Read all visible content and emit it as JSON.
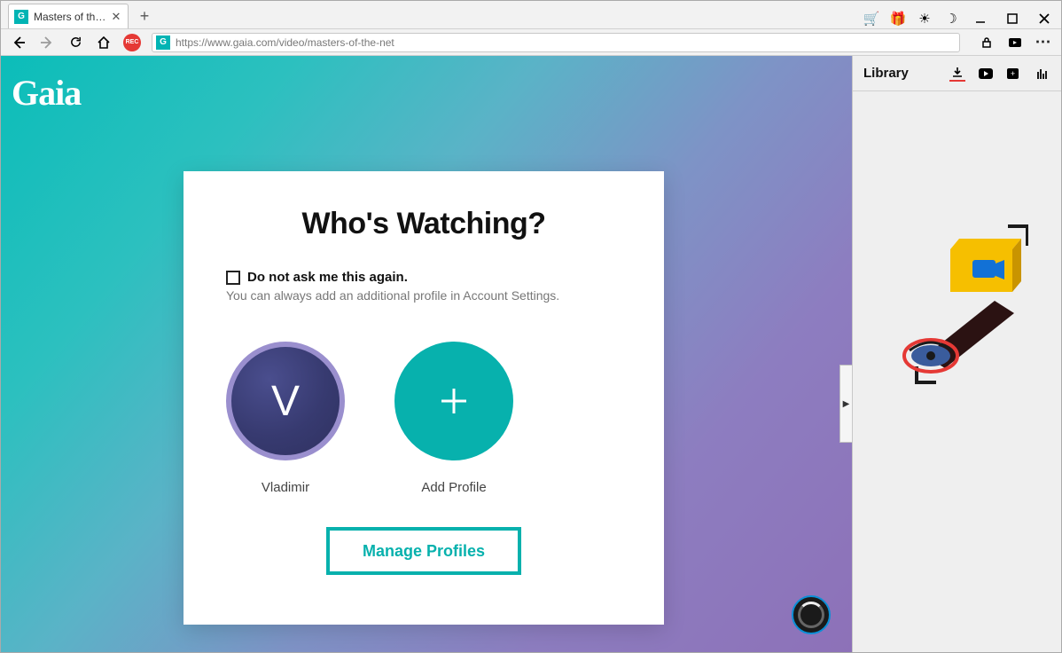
{
  "browser": {
    "tab_title": "Masters of the Ne",
    "url": "https://www.gaia.com/video/masters-of-the-net",
    "favicon_letter": "G"
  },
  "page": {
    "logo": "Gaia",
    "heading": "Who's Watching?",
    "checkbox_label": "Do not ask me this again.",
    "checkbox_sub": "You can always add an additional profile in Account Settings.",
    "profiles": [
      {
        "letter": "V",
        "label": "Vladimir"
      }
    ],
    "add_profile_label": "Add Profile",
    "manage_button": "Manage Profiles"
  },
  "sidebar": {
    "title": "Library"
  }
}
